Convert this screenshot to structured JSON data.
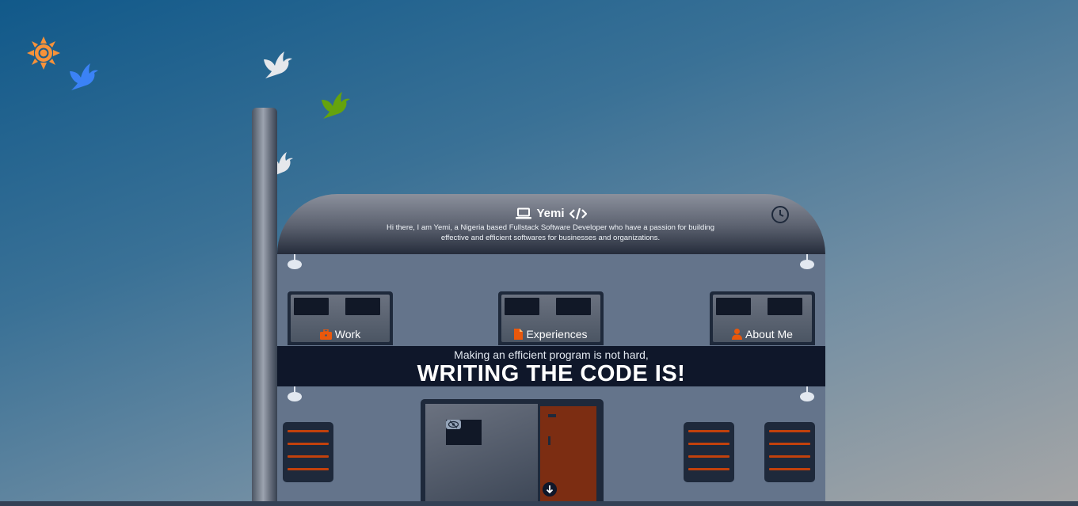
{
  "scene": {
    "sun_icon": "sun-icon",
    "birds": [
      "bird-blue-icon",
      "bird-white-icon",
      "bird-green-icon",
      "bird-white-icon"
    ],
    "colors": {
      "sun": "#f7923a",
      "bird_blue": "#3b82f6",
      "bird_white": "#e5e7eb",
      "bird_green": "#65a30d",
      "accent": "#ea580c"
    }
  },
  "header": {
    "laptop_icon": "laptop-icon",
    "name": "Yemi",
    "code_icon": "code-icon",
    "tagline": "Hi there, I am Yemi, a Nigeria based Fullstack Software Developer who have a passion for building effective and efficient softwares for businesses and organizations.",
    "clock_icon": "clock-icon"
  },
  "nav": {
    "work": "Work",
    "experiences": "Experiences",
    "about": "About Me"
  },
  "banner": {
    "subtitle": "Making an efficient program is not hard,",
    "headline": "WRITING THE CODE IS!"
  }
}
